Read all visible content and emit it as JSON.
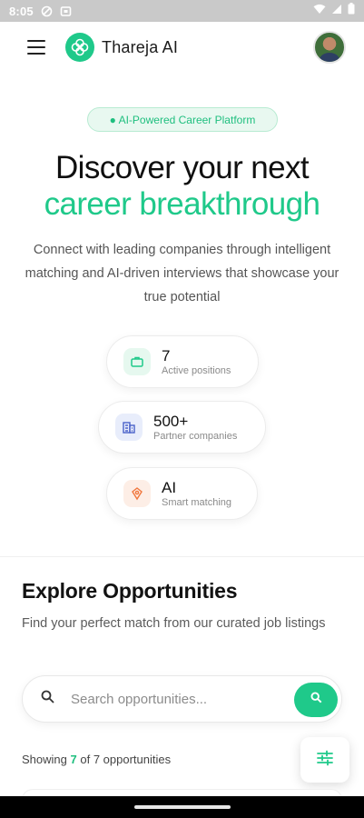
{
  "status_bar": {
    "time": "8:05"
  },
  "header": {
    "brand_name": "Thareja AI",
    "menu_icon": "hamburger-menu-icon",
    "logo_icon": "knot-logo-icon"
  },
  "hero": {
    "badge": "● AI-Powered Career Platform",
    "headline_line1": "Discover your next",
    "headline_line2": "career breakthrough",
    "description": "Connect with leading companies through intelligent matching and AI-driven interviews that showcase your true potential"
  },
  "stats": [
    {
      "value": "7",
      "label": "Active positions",
      "icon": "briefcase-icon",
      "color": "#1fc98a",
      "bg": "#e6f8ef"
    },
    {
      "value": "500+",
      "label": "Partner companies",
      "icon": "building-icon",
      "color": "#4a62c9",
      "bg": "#e8edfb"
    },
    {
      "value": "AI",
      "label": "Smart matching",
      "icon": "target-icon",
      "color": "#f0773d",
      "bg": "#fdeee6"
    }
  ],
  "explore": {
    "title": "Explore Opportunities",
    "subtitle": "Find your perfect match from our curated job listings",
    "search_placeholder": "Search opportunities...",
    "results_prefix": "Showing",
    "results_shown": "7",
    "results_middle": "of 7 opportunities"
  },
  "colors": {
    "accent": "#1fc98a",
    "text_primary": "#111111",
    "text_muted": "#555555"
  }
}
